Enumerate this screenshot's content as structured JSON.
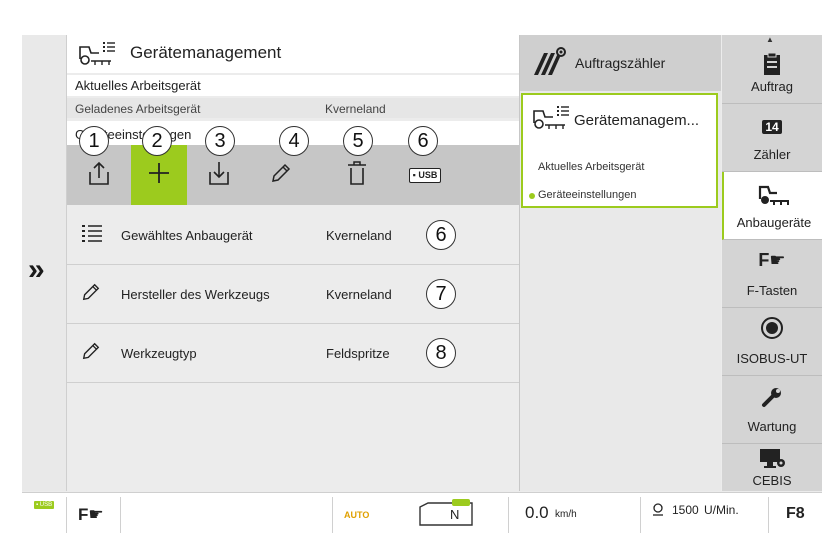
{
  "left_strip": {
    "expand_glyph": "»"
  },
  "main": {
    "title": "Gerätemanagement",
    "current_device_label": "Aktuelles Arbeitsgerät",
    "loaded_device_label": "Geladenes Arbeitsgerät",
    "loaded_device_value": "Kverneland",
    "settings_label": "Geräteeinstellungen",
    "toolbar": [
      {
        "icon": "export-icon",
        "callout": "1"
      },
      {
        "icon": "add-icon",
        "callout": "2",
        "selected": true
      },
      {
        "icon": "import-icon",
        "callout": "3"
      },
      {
        "icon": "pencil-icon",
        "callout": "4"
      },
      {
        "icon": "trash-icon",
        "callout": "5"
      },
      {
        "icon": "usb-icon",
        "callout": "6",
        "usb_text": "USB"
      }
    ],
    "rows": [
      {
        "icon": "list-icon",
        "label": "Gewähltes Anbaugerät",
        "value": "Kverneland",
        "callout": "6"
      },
      {
        "icon": "pencil-icon",
        "label": "Hersteller des Werkzeugs",
        "value": "Kverneland",
        "callout": "7"
      },
      {
        "icon": "pencil-icon",
        "label": "Werkzeugtyp",
        "value": "Feldspritze",
        "callout": "8"
      }
    ]
  },
  "middle": {
    "counter_title": "Auftragszähler",
    "card_title": "Gerätemanagem...",
    "card_item1": "Aktuelles Arbeitsgerät",
    "card_item2": "Geräteeinstellungen"
  },
  "nav": [
    {
      "label": "Auftrag",
      "icon": "clipboard-icon"
    },
    {
      "label": "Zähler",
      "icon": "counter-icon",
      "icon_text": "14"
    },
    {
      "label": "Anbaugeräte",
      "icon": "implement-icon",
      "selected": true
    },
    {
      "label": "F-Tasten",
      "icon": "f-key-icon",
      "icon_text": "F"
    },
    {
      "label": "ISOBUS-UT",
      "icon": "isobus-icon"
    },
    {
      "label": "Wartung",
      "icon": "wrench-icon"
    },
    {
      "label": "CEBIS",
      "icon": "monitor-icon"
    }
  ],
  "status_bar": {
    "usb_text": "USB",
    "f_text": "F",
    "auto_text": "AUTO",
    "gear_text": "N",
    "speed_value": "0.0",
    "speed_unit": "km/h",
    "rpm1_value": "1500",
    "rpm1_unit": "U/Min.",
    "f8_text": "F8",
    "colors": {
      "accent": "#9ccb1e",
      "auto": "#e0a000"
    }
  }
}
